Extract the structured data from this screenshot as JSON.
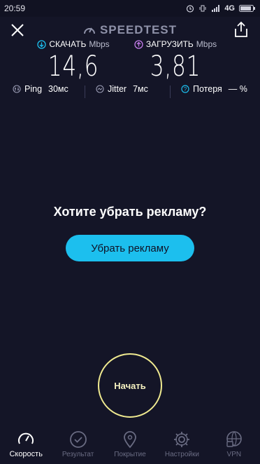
{
  "status": {
    "time": "20:59",
    "network": "4G"
  },
  "header": {
    "brand": "SPEEDTEST"
  },
  "download": {
    "label": "СКАЧАТЬ",
    "unit": "Mbps",
    "value": "14,6"
  },
  "upload": {
    "label": "ЗАГРУЗИТЬ",
    "unit": "Mbps",
    "value": "3,81"
  },
  "stats": {
    "ping_label": "Ping",
    "ping_value": "30мс",
    "jitter_label": "Jitter",
    "jitter_value": "7мс",
    "loss_label": "Потеря",
    "loss_value": "— %"
  },
  "ad": {
    "title": "Хотите убрать рекламу?",
    "button": "Убрать рекламу"
  },
  "go_label": "Начать",
  "tabs": [
    {
      "label": "Скорость",
      "icon": "speedometer-icon",
      "active": true
    },
    {
      "label": "Результат",
      "icon": "check-circle-icon",
      "active": false
    },
    {
      "label": "Покрытие",
      "icon": "map-pin-icon",
      "active": false
    },
    {
      "label": "Настройки",
      "icon": "gear-icon",
      "active": false
    },
    {
      "label": "VPN",
      "icon": "globe-lock-icon",
      "active": false
    }
  ],
  "colors": {
    "background": "#141527",
    "accent": "#1cbfee",
    "go_ring": "#f0ea90",
    "download_icon": "#1cbfee",
    "upload_icon": "#c27be8"
  }
}
